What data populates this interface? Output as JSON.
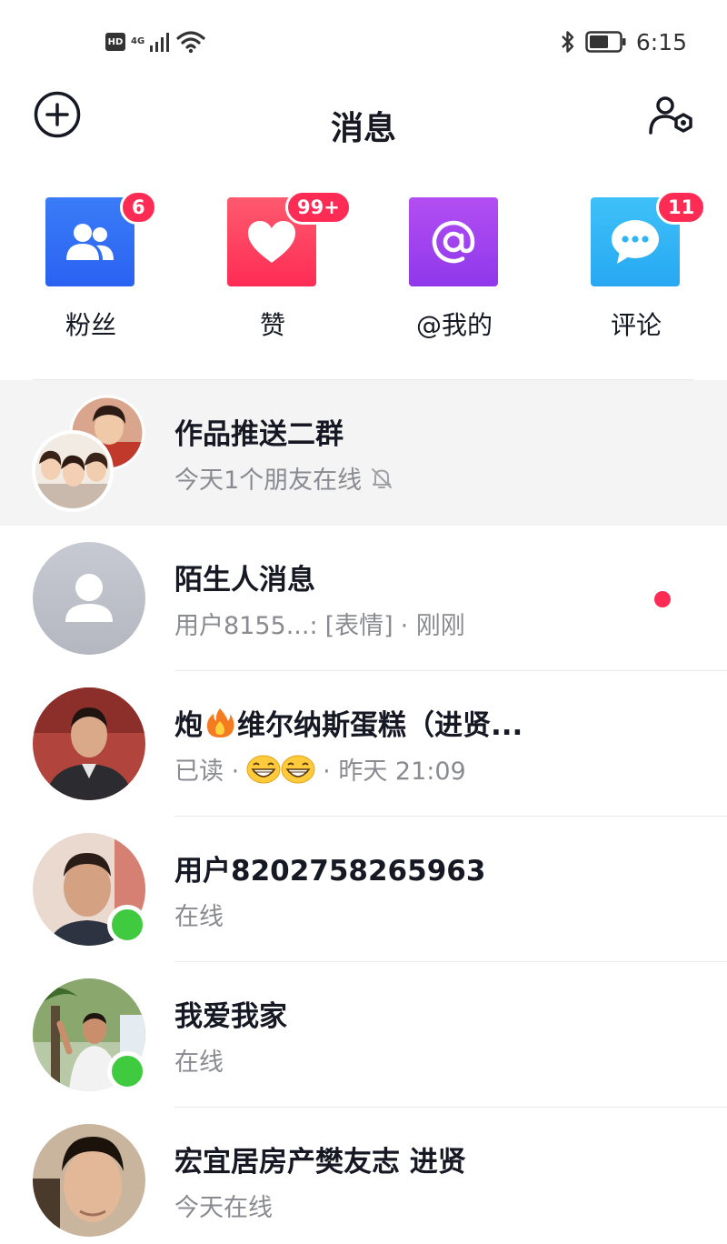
{
  "status_bar": {
    "hd": "HD",
    "network": "4G",
    "time": "6:15"
  },
  "header": {
    "title": "消息",
    "add_icon": "plus-circle-icon",
    "settings_icon": "user-settings-icon"
  },
  "quick_actions": [
    {
      "label": "粉丝",
      "badge": "6",
      "icon": "fans-icon",
      "color": "#2f6ef6"
    },
    {
      "label": "赞",
      "badge": "99+",
      "icon": "heart-icon",
      "color": "#fe2c55"
    },
    {
      "label": "@我的",
      "badge": "",
      "icon": "at-icon",
      "color": "#9b3ef0"
    },
    {
      "label": "评论",
      "badge": "11",
      "icon": "comment-icon",
      "color": "#2fb4f5"
    }
  ],
  "conversations": [
    {
      "title": "作品推送二群",
      "subtitle": "今天1个朋友在线",
      "muted": true
    },
    {
      "title": "陌生人消息",
      "subtitle_user": "用户8155...:",
      "subtitle_msg": "[表情]",
      "subtitle_time": "· 刚刚",
      "unread": true
    },
    {
      "title_a": "炮",
      "title_b": "维尔纳斯蛋糕（进贤...",
      "subtitle_status": "已读 ·",
      "subtitle_time": "· 昨天 21:09"
    },
    {
      "title": "用户8202758265963",
      "subtitle": "在线",
      "online": true
    },
    {
      "title": "我爱我家",
      "subtitle": "在线",
      "online": true
    },
    {
      "title": "宏宜居房产樊友志  进贤",
      "subtitle": "今天在线"
    }
  ],
  "colors": {
    "accent": "#fe2c55",
    "online": "#3fca3f",
    "text_primary": "#161823",
    "text_secondary": "#8a8b91"
  }
}
